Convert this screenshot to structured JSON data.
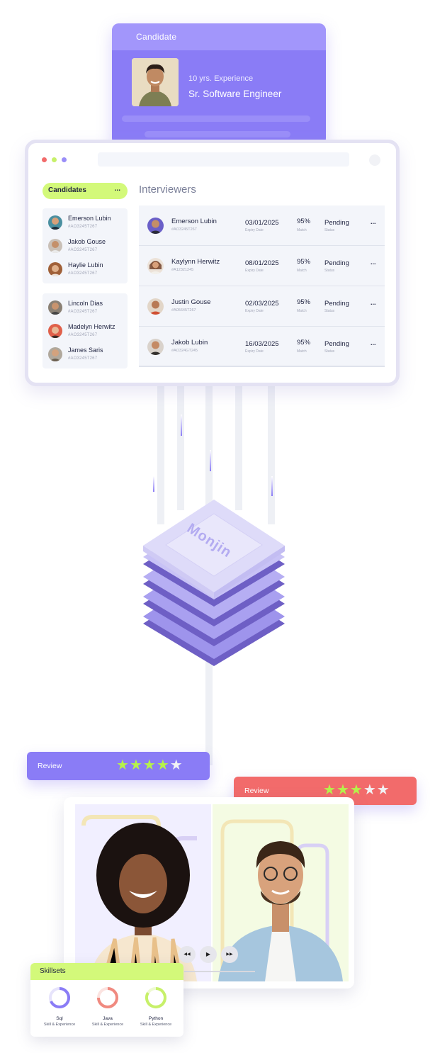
{
  "candidate_card": {
    "title": "Candidate",
    "experience": "10 yrs. Experience",
    "role": "Sr. Software Engineer"
  },
  "sidebar": {
    "tab_label": "Candidates",
    "tab_more": "...",
    "group1": [
      {
        "name": "Emerson Lubin",
        "id": "#AO3245T267"
      },
      {
        "name": "Jakob Gouse",
        "id": "#AO3245T267"
      },
      {
        "name": "Haylie Lubin",
        "id": "#AO3245T267"
      }
    ],
    "group2": [
      {
        "name": "Lincoln Dias",
        "id": "#AO3245T267"
      },
      {
        "name": "Madelyn Herwitz",
        "id": "#AO3245T267"
      },
      {
        "name": "James Saris",
        "id": "#AO3245T267"
      }
    ]
  },
  "interviewers": {
    "title": "Interviewers",
    "date_label": "Expiry Date",
    "match_label": "Match",
    "status_label": "Status",
    "more": "...",
    "rows": [
      {
        "name": "Emerson Lubin",
        "id": "#AO3245T267",
        "date": "03/01/2025",
        "match": "95%",
        "status": "Pending"
      },
      {
        "name": "Kaylynn Herwitz",
        "id": "#A12321245",
        "date": "08/01/2025",
        "match": "95%",
        "status": "Pending"
      },
      {
        "name": "Justin Gouse",
        "id": "#A05645T267",
        "date": "02/03/2025",
        "match": "95%",
        "status": "Pending"
      },
      {
        "name": "Jakob Lubin",
        "id": "#AO324GT245",
        "date": "16/03/2025",
        "match": "95%",
        "status": "Pending"
      }
    ]
  },
  "logo": {
    "text": "Monjin"
  },
  "review_left": {
    "label": "Review",
    "rating": 4,
    "max": 5,
    "color": "#8a7cf6"
  },
  "review_right": {
    "label": "Review",
    "rating": 3,
    "max": 5,
    "color": "#f26b6b"
  },
  "video_controls": {
    "rewind": "◀◀",
    "play": "▶",
    "forward": "▶▶"
  },
  "skillsets": {
    "title": "Skillsets",
    "items": [
      {
        "name": "Sql",
        "sub": "Skill & Experience",
        "color": "#8a7cf6"
      },
      {
        "name": "Java",
        "sub": "Skill & Experience",
        "color": "#f08a80"
      },
      {
        "name": "Python",
        "sub": "Skill & Experience",
        "color": "#c7f06a"
      }
    ]
  },
  "colors": {
    "accent_purple": "#8a7cf6",
    "accent_lime": "#d3f97a",
    "accent_red": "#f26b6b"
  }
}
